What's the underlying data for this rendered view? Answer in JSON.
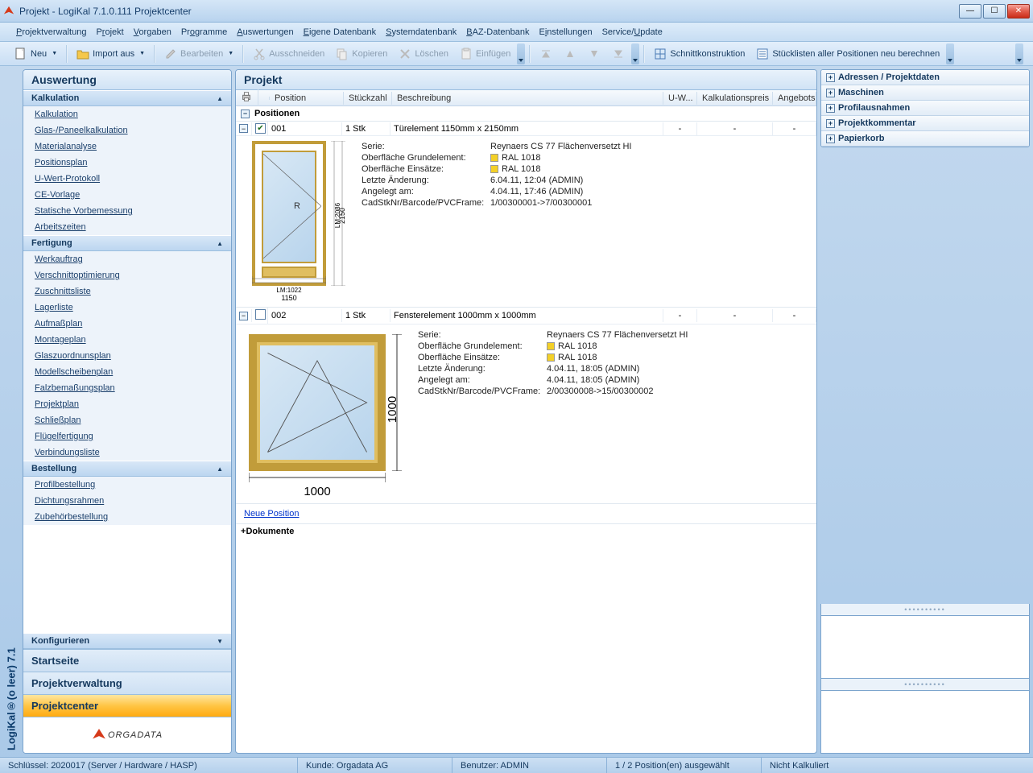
{
  "window": {
    "title": "Projekt - LogiKal 7.1.0.111 Projektcenter"
  },
  "menubar": [
    "Projektverwaltung",
    "Projekt",
    "Vorgaben",
    "Programme",
    "Auswertungen",
    "Eigene Datenbank",
    "Systemdatenbank",
    "BAZ-Datenbank",
    "Einstellungen",
    "Service/Update"
  ],
  "toolbar": {
    "neu": "Neu",
    "import": "Import aus",
    "bearbeiten": "Bearbeiten",
    "ausschneiden": "Ausschneiden",
    "kopieren": "Kopieren",
    "loeschen": "Löschen",
    "einfuegen": "Einfügen",
    "schnitt": "Schnittkonstruktion",
    "stueck": "Stücklisten aller Positionen neu berechnen"
  },
  "leftRail": "LogiKal®(o leer) 7.1",
  "sidebar": {
    "title": "Auswertung",
    "sections": {
      "kalk": {
        "label": "Kalkulation",
        "items": [
          "Kalkulation",
          "Glas-/Paneelkalkulation",
          "Materialanalyse",
          "Positionsplan",
          "U-Wert-Protokoll",
          "CE-Vorlage",
          "Statische Vorbemessung",
          "Arbeitszeiten"
        ]
      },
      "fert": {
        "label": "Fertigung",
        "items": [
          "Werkauftrag",
          "Verschnittoptimierung",
          "Zuschnittsliste",
          "Lagerliste",
          "Aufmaßplan",
          "Montageplan",
          "Glaszuordnunsplan",
          "Modellscheibenplan",
          "Falzbemaßungsplan",
          "Projektplan",
          "Schließplan",
          "Flügelfertigung",
          "Verbindungsliste"
        ]
      },
      "best": {
        "label": "Bestellung",
        "items": [
          "Profilbestellung",
          "Dichtungsrahmen",
          "Zubehörbestellung"
        ]
      },
      "konf": {
        "label": "Konfigurieren"
      }
    },
    "nav": {
      "start": "Startseite",
      "projv": "Projektverwaltung",
      "projc": "Projektcenter"
    },
    "orgadata": "ORGADATA"
  },
  "project": {
    "title": "Projekt",
    "columns": {
      "position": "Position",
      "stueckzahl": "Stückzahl",
      "beschreibung": "Beschreibung",
      "uw": "U-W...",
      "kalkpreis": "Kalkulationspreis",
      "angebot": "Angebotsp"
    },
    "groupPositionen": "Positionen",
    "groupDokumente": "Dokumente",
    "newPosition": "Neue Position",
    "positions": [
      {
        "checked": true,
        "num": "001",
        "qty": "1 Stk",
        "desc": "Türelement 1150mm x 2150mm",
        "uw": "-",
        "kalk": "-",
        "ang": "-",
        "serie": "Reynaers CS 77  Flächenversetzt HI",
        "oberGrund": "RAL 1018",
        "oberEin": "RAL 1018",
        "letzteAend": "6.04.11, 12:04  (ADMIN)",
        "angelegt": "4.04.11, 17:46  (ADMIN)",
        "barcode": "1/00300001->7/00300001",
        "dimW": "1150",
        "dimH": "2150",
        "dimLM": "LM:1022",
        "dimLMH": "LM:2086"
      },
      {
        "checked": false,
        "num": "002",
        "qty": "1 Stk",
        "desc": "Fensterelement 1000mm x 1000mm",
        "uw": "-",
        "kalk": "-",
        "ang": "-",
        "serie": "Reynaers CS 77  Flächenversetzt HI",
        "oberGrund": "RAL 1018",
        "oberEin": "RAL 1018",
        "letzteAend": "4.04.11, 18:05  (ADMIN)",
        "angelegt": "4.04.11, 18:05  (ADMIN)",
        "barcode": "2/00300008->15/00300002",
        "dimW": "1000",
        "dimH": "1000"
      }
    ],
    "detailLabels": {
      "serie": "Serie:",
      "oberGrund": "Oberfläche Grundelement:",
      "oberEin": "Oberfläche Einsätze:",
      "letzteAend": "Letzte Änderung:",
      "angelegt": "Angelegt am:",
      "barcode": "CadStkNr/Barcode/PVCFrame:"
    }
  },
  "rightPanel": [
    "Adressen / Projektdaten",
    "Maschinen",
    "Profilausnahmen",
    "Projektkommentar",
    "Papierkorb"
  ],
  "status": {
    "schluessel": "Schlüssel: 2020017 (Server / Hardware / HASP)",
    "kunde": "Kunde: Orgadata AG",
    "benutzer": "Benutzer: ADMIN",
    "auswahl": "1 / 2 Position(en) ausgewählt",
    "kalk": "Nicht Kalkuliert"
  }
}
